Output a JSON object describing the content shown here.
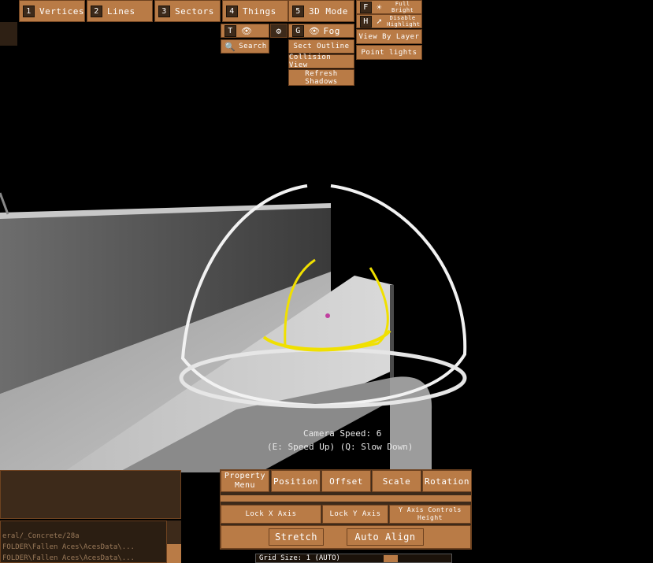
{
  "toolbar": {
    "vertices": {
      "key": "1",
      "label": "Vertices"
    },
    "lines": {
      "key": "2",
      "label": "Lines"
    },
    "sectors": {
      "key": "3",
      "label": "Sectors"
    },
    "things": {
      "key": "4",
      "label": "Things"
    },
    "mode3d": {
      "key": "5",
      "label": "3D Mode"
    },
    "fullbright": {
      "key": "F",
      "label": "Full Bright"
    },
    "disable_highlight": {
      "key": "H",
      "label": "Disable Highlight"
    },
    "view_by_layer": "View By Layer",
    "point_lights": "Point lights",
    "t_key": "T",
    "g_key": "G",
    "fog": "Fog",
    "search": "Search",
    "sect_outline": "Sect Outline",
    "collision_view": "Collision View",
    "refresh_shadows": "Refresh Shadows"
  },
  "camera": {
    "speed": "Camera Speed: 6",
    "hint": "(E: Speed Up) (Q: Slow Down)"
  },
  "property_panel": {
    "tabs": [
      "Property Menu",
      "Position",
      "Offset",
      "Scale",
      "Rotation"
    ],
    "lock_x": "Lock X Axis",
    "lock_y": "Lock Y Axis",
    "y_axis_height": "Y Axis Controls Height",
    "stretch": "Stretch",
    "auto_align": "Auto Align"
  },
  "grid": {
    "label": "Grid Size: 1 (AUTO)"
  },
  "file_panel": {
    "rows": [
      "eral/_Concrete/28a",
      "FOLDER\\Fallen Aces\\AcesData\\...",
      "FOLDER\\Fallen Aces\\AcesData\\..."
    ]
  },
  "colors": {
    "accent": "#b97b46",
    "dark": "#3d2a1a",
    "gizmo": "#f0e000"
  }
}
